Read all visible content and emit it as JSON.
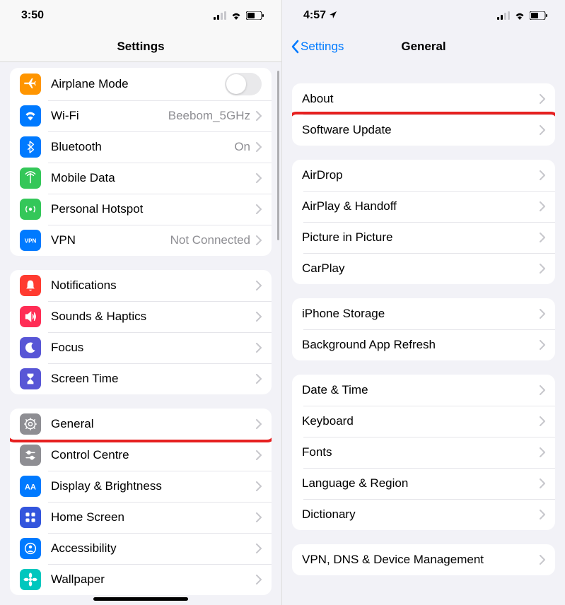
{
  "left": {
    "status": {
      "time": "3:50"
    },
    "nav": {
      "title": "Settings"
    },
    "group1": [
      {
        "id": "airplane",
        "label": "Airplane Mode",
        "iconBg": "#ff9500",
        "glyph": "airplane",
        "control": "toggle"
      },
      {
        "id": "wifi",
        "label": "Wi-Fi",
        "value": "Beebom_5GHz",
        "iconBg": "#007aff",
        "glyph": "wifi",
        "control": "disclosure"
      },
      {
        "id": "bluetooth",
        "label": "Bluetooth",
        "value": "On",
        "iconBg": "#007aff",
        "glyph": "bluetooth",
        "control": "disclosure"
      },
      {
        "id": "mobiledata",
        "label": "Mobile Data",
        "iconBg": "#34c759",
        "glyph": "antenna",
        "control": "disclosure"
      },
      {
        "id": "hotspot",
        "label": "Personal Hotspot",
        "iconBg": "#34c759",
        "glyph": "hotspot",
        "control": "disclosure"
      },
      {
        "id": "vpn",
        "label": "VPN",
        "value": "Not Connected",
        "iconBg": "#007aff",
        "glyph": "vpn",
        "control": "disclosure"
      }
    ],
    "group2": [
      {
        "id": "notifications",
        "label": "Notifications",
        "iconBg": "#ff3b30",
        "glyph": "bell",
        "control": "disclosure"
      },
      {
        "id": "sounds",
        "label": "Sounds & Haptics",
        "iconBg": "#ff2d55",
        "glyph": "speaker",
        "control": "disclosure"
      },
      {
        "id": "focus",
        "label": "Focus",
        "iconBg": "#5856d6",
        "glyph": "moon",
        "control": "disclosure"
      },
      {
        "id": "screentime",
        "label": "Screen Time",
        "iconBg": "#5856d6",
        "glyph": "hourglass",
        "control": "disclosure"
      }
    ],
    "group3": [
      {
        "id": "general",
        "label": "General",
        "iconBg": "#8e8e93",
        "glyph": "gear",
        "control": "disclosure",
        "highlight": true
      },
      {
        "id": "controlcentre",
        "label": "Control Centre",
        "iconBg": "#8e8e93",
        "glyph": "sliders",
        "control": "disclosure"
      },
      {
        "id": "display",
        "label": "Display & Brightness",
        "iconBg": "#007aff",
        "glyph": "AA",
        "control": "disclosure"
      },
      {
        "id": "homescreen",
        "label": "Home Screen",
        "iconBg": "#3355dd",
        "glyph": "grid",
        "control": "disclosure"
      },
      {
        "id": "accessibility",
        "label": "Accessibility",
        "iconBg": "#007aff",
        "glyph": "person",
        "control": "disclosure"
      },
      {
        "id": "wallpaper",
        "label": "Wallpaper",
        "iconBg": "#00c7be",
        "glyph": "flower",
        "control": "disclosure"
      }
    ]
  },
  "right": {
    "status": {
      "time": "4:57"
    },
    "nav": {
      "back": "Settings",
      "title": "General"
    },
    "groups": [
      [
        {
          "id": "about",
          "label": "About"
        },
        {
          "id": "softwareupdate",
          "label": "Software Update",
          "highlight": true
        }
      ],
      [
        {
          "id": "airdrop",
          "label": "AirDrop"
        },
        {
          "id": "airplay",
          "label": "AirPlay & Handoff"
        },
        {
          "id": "pip",
          "label": "Picture in Picture"
        },
        {
          "id": "carplay",
          "label": "CarPlay"
        }
      ],
      [
        {
          "id": "storage",
          "label": "iPhone Storage"
        },
        {
          "id": "bgrefresh",
          "label": "Background App Refresh"
        }
      ],
      [
        {
          "id": "datetime",
          "label": "Date & Time"
        },
        {
          "id": "keyboard",
          "label": "Keyboard"
        },
        {
          "id": "fonts",
          "label": "Fonts"
        },
        {
          "id": "language",
          "label": "Language & Region"
        },
        {
          "id": "dictionary",
          "label": "Dictionary"
        }
      ],
      [
        {
          "id": "vpndns",
          "label": "VPN, DNS & Device Management"
        }
      ]
    ]
  }
}
